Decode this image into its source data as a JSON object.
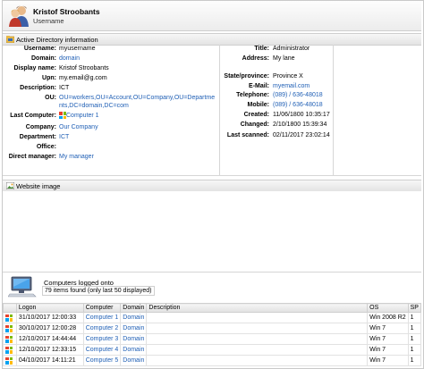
{
  "user": {
    "name": "Kristof Stroobants",
    "subtitle": "Username"
  },
  "ad": {
    "title": "Active Directory information",
    "left": [
      {
        "label": "Username:",
        "value": "myusername",
        "link": false
      },
      {
        "label": "Domain:",
        "value": "domain",
        "link": true
      },
      {
        "label": "Display name:",
        "value": "Kristof Stroobants",
        "link": false
      },
      {
        "label": "Upn:",
        "value": "my.email@g.com",
        "link": false
      },
      {
        "label": "Description:",
        "value": "ICT",
        "link": false
      },
      {
        "label": "OU:",
        "value": [
          "OU=workers,OU=Account,OU=Company,OU=Departme",
          "nts,DC=domain,DC=com"
        ],
        "link": true
      },
      {
        "label": "Last Computer:",
        "value": "Computer 1",
        "link": true
      },
      {
        "label": "Company:",
        "value": "Our Company",
        "link": true
      },
      {
        "label": "Department:",
        "value": "ICT",
        "link": true
      },
      {
        "label": "Office:",
        "value": "",
        "link": false
      },
      {
        "label": "Direct manager:",
        "value": "My manager",
        "link": true
      }
    ],
    "right": [
      {
        "label": "Title:",
        "value": "Administrator",
        "link": false
      },
      {
        "label": "Address:",
        "value": "My lane",
        "link": false
      },
      {
        "label": "State/province:",
        "value": "Province X",
        "link": false
      },
      {
        "label": "E-Mail:",
        "value": "myemail.com",
        "link": true
      },
      {
        "label": "Telephone:",
        "value": "(089) / 636-48018",
        "link": true
      },
      {
        "label": "Mobile:",
        "value": "(089) / 636-48018",
        "link": true
      },
      {
        "label": "Created:",
        "value": "11/06/1800 10:35:17",
        "link": false
      },
      {
        "label": "Changed:",
        "value": "2/10/1800 15:39:34",
        "link": false
      },
      {
        "label": "Last scanned:",
        "value": "02/11/2017 23:02:14",
        "link": false
      }
    ]
  },
  "website": {
    "title": "Website image"
  },
  "computers": {
    "title": "Computers logged onto",
    "subtitle": "79 items found (only last 50 displayed)",
    "columns": [
      "Logon",
      "Computer",
      "Domain",
      "Description",
      "OS",
      "SP"
    ],
    "rows": [
      [
        "31/10/2017 12:00:33",
        "Computer 1",
        "Domain",
        "",
        "Win 2008 R2",
        "1"
      ],
      [
        "30/10/2017 12:00:28",
        "Computer 2",
        "Domain",
        "",
        "Win 7",
        "1"
      ],
      [
        "12/10/2017 14:44:44",
        "Computer 3",
        "Domain",
        "",
        "Win 7",
        "1"
      ],
      [
        "12/10/2017 12:33:15",
        "Computer 4",
        "Domain",
        "",
        "Win 7",
        "1"
      ],
      [
        "04/10/2017 14:11:21",
        "Computer 5",
        "Domain",
        "",
        "Win 7",
        "1"
      ]
    ]
  },
  "colors": {
    "link": "#1f5fb5",
    "section_bg": "#e3e3e3",
    "windows_red": "#e8412c",
    "windows_green": "#7cbb00",
    "windows_blue": "#00a1f1",
    "windows_yellow": "#ffbb00"
  },
  "icons": {
    "user": "user-group-icon",
    "section": "folder-icon",
    "website": "image-icon",
    "computers": "computer-icon",
    "windows": "windows-logo-icon"
  }
}
